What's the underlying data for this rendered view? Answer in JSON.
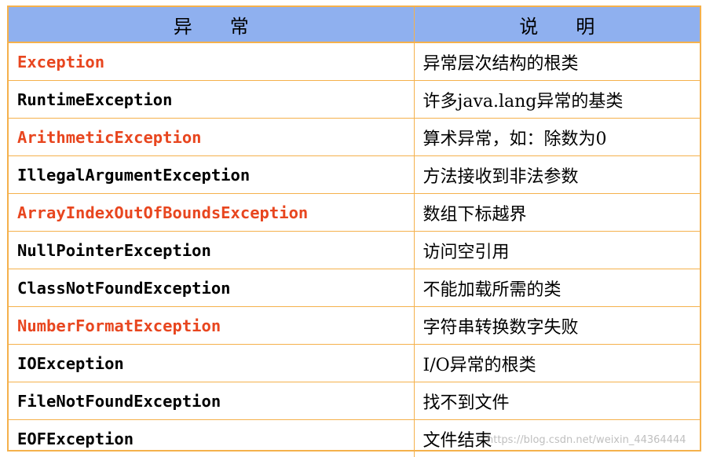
{
  "table": {
    "headers": [
      "异　　常",
      "说　　明"
    ],
    "rows": [
      {
        "exception": "Exception",
        "description": "异常层次结构的根类",
        "highlight": true
      },
      {
        "exception": "RuntimeException",
        "description": "许多java.lang异常的基类",
        "highlight": false
      },
      {
        "exception": "ArithmeticException",
        "description": "算术异常，如：除数为0",
        "highlight": true
      },
      {
        "exception": "IllegalArgumentException",
        "description": "方法接收到非法参数",
        "highlight": false
      },
      {
        "exception": "ArrayIndexOutOfBoundsException",
        "description": "数组下标越界",
        "highlight": true
      },
      {
        "exception": "NullPointerException",
        "description": "访问空引用",
        "highlight": false
      },
      {
        "exception": "ClassNotFoundException",
        "description": "不能加载所需的类",
        "highlight": false
      },
      {
        "exception": "NumberFormatException",
        "description": "字符串转换数字失败",
        "highlight": true
      },
      {
        "exception": "IOException",
        "description": "I/O异常的根类",
        "highlight": false
      },
      {
        "exception": "FileNotFoundException",
        "description": "找不到文件",
        "highlight": false
      },
      {
        "exception": "EOFException",
        "description": "文件结束",
        "highlight": false
      }
    ]
  },
  "colors": {
    "header_background": "#8fb0ef",
    "border": "#f5b14c",
    "highlight_text": "#e8461f",
    "normal_text": "#000000"
  },
  "watermark": "https://blog.csdn.net/weixin_44364444"
}
